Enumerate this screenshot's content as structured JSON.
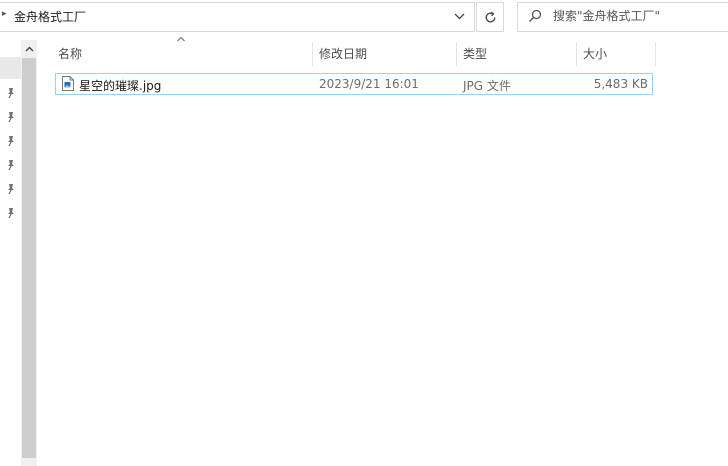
{
  "address_bar": {
    "path": "金舟格式工厂"
  },
  "search": {
    "placeholder": "搜索\"金舟格式工厂\""
  },
  "columns": {
    "name": "名称",
    "date_modified": "修改日期",
    "type": "类型",
    "size": "大小"
  },
  "files": [
    {
      "name": "星空的璀璨.jpg",
      "date_modified": "2023/9/21 16:01",
      "type": "JPG 文件",
      "size": "5,483 KB"
    }
  ],
  "icons": {
    "nav_pins": [
      "pin-icon",
      "pin-icon",
      "pin-icon",
      "pin-icon",
      "pin-icon",
      "pin-icon"
    ],
    "file": "jpg-file-icon"
  }
}
